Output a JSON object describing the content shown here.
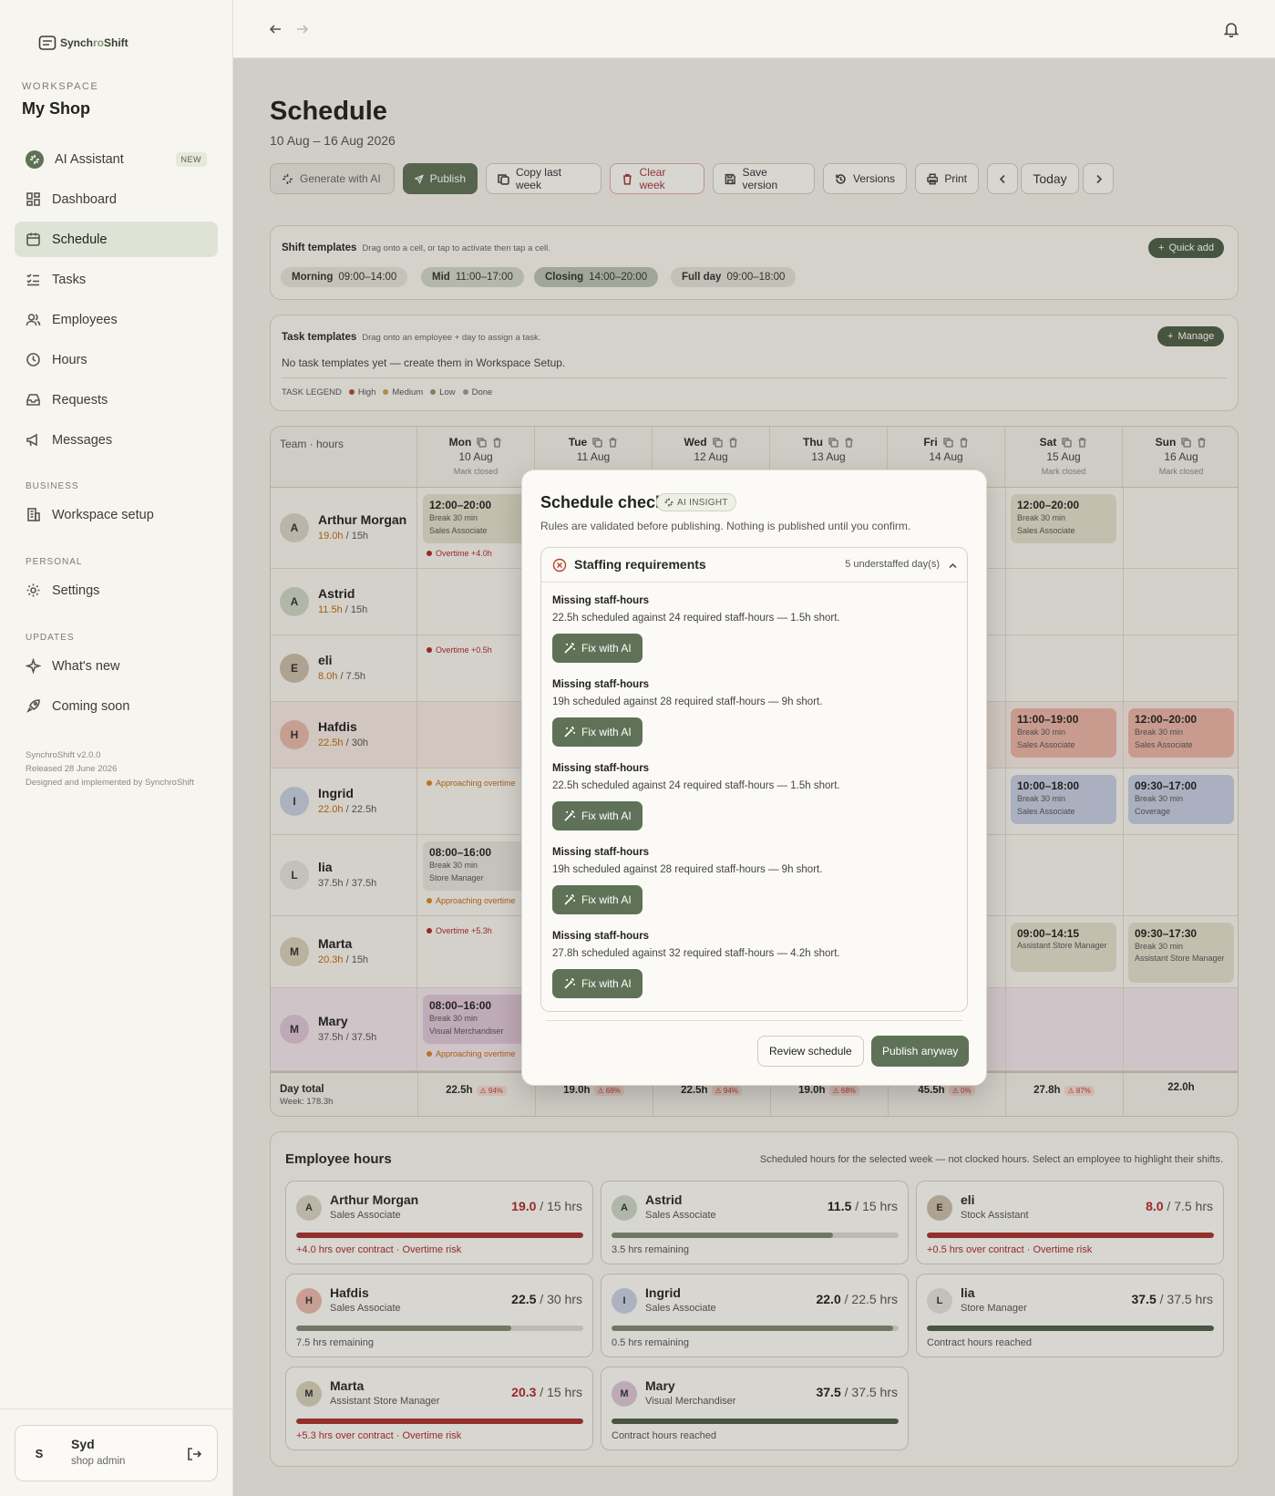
{
  "app": {
    "name_a": "Synch",
    "name_b": "ro",
    "name_c": "Shift"
  },
  "workspace": {
    "label": "WORKSPACE",
    "name": "My Shop"
  },
  "nav": {
    "ai": "AI Assistant",
    "new": "NEW",
    "dashboard": "Dashboard",
    "schedule": "Schedule",
    "tasks": "Tasks",
    "employees": "Employees",
    "hours": "Hours",
    "requests": "Requests",
    "messages": "Messages",
    "business_label": "BUSINESS",
    "workspace_setup": "Workspace setup",
    "personal_label": "PERSONAL",
    "settings": "Settings",
    "updates_label": "UPDATES",
    "whats_new": "What's new",
    "coming_soon": "Coming soon"
  },
  "version": {
    "line1": "SynchroShift v2.0.0",
    "line2": "Released 28 June 2026",
    "line3": "Designed and implemented by SynchroShift"
  },
  "user": {
    "initial": "S",
    "name": "Syd",
    "role": "shop admin"
  },
  "page": {
    "title": "Schedule",
    "range": "10 Aug – 16 Aug 2026"
  },
  "toolbar": {
    "generate": "Generate with AI",
    "publish": "Publish",
    "copy": "Copy last week",
    "clear": "Clear week",
    "save": "Save version",
    "versions": "Versions",
    "print": "Print",
    "today": "Today"
  },
  "shift_templates": {
    "title": "Shift templates",
    "hint": "Drag onto a cell, or tap to activate then tap a cell.",
    "quick_add": "Quick add",
    "chips": [
      {
        "name": "Morning",
        "time": "09:00–14:00"
      },
      {
        "name": "Mid",
        "time": "11:00–17:00"
      },
      {
        "name": "Closing",
        "time": "14:00–20:00"
      },
      {
        "name": "Full day",
        "time": "09:00–18:00"
      }
    ]
  },
  "task_templates": {
    "title": "Task templates",
    "hint": "Drag onto an employee + day to assign a task.",
    "manage": "Manage",
    "empty": "No task templates yet — create them in Workspace Setup.",
    "legend_label": "TASK LEGEND",
    "legend": [
      "High",
      "Medium",
      "Low",
      "Done"
    ],
    "legend_colors": [
      "#b24a3f",
      "#c9a44a",
      "#8a9a72",
      "#9a9a92"
    ]
  },
  "grid": {
    "corner": "Team · hours",
    "days": [
      {
        "day": "Mon",
        "date": "10 Aug",
        "note": "Mark closed"
      },
      {
        "day": "Tue",
        "date": "11 Aug",
        "note": ""
      },
      {
        "day": "Wed",
        "date": "12 Aug",
        "note": ""
      },
      {
        "day": "Thu",
        "date": "13 Aug",
        "note": ""
      },
      {
        "day": "Fri",
        "date": "14 Aug",
        "note": ""
      },
      {
        "day": "Sat",
        "date": "15 Aug",
        "note": "Mark closed"
      },
      {
        "day": "Sun",
        "date": "16 Aug",
        "note": "Mark closed"
      }
    ],
    "employees": [
      {
        "initial": "A",
        "name": "Arthur Morgan",
        "worked": "19.0h",
        "contract": " / 15h"
      },
      {
        "initial": "A",
        "name": "Astrid",
        "worked": "11.5h",
        "contract": " / 15h"
      },
      {
        "initial": "E",
        "name": "eli",
        "worked": "8.0h",
        "contract": " / 7.5h"
      },
      {
        "initial": "H",
        "name": "Hafdis",
        "worked": "22.5h",
        "contract": " / 30h"
      },
      {
        "initial": "I",
        "name": "Ingrid",
        "worked": "22.0h",
        "contract": " / 22.5h"
      },
      {
        "initial": "L",
        "name": "lia",
        "worked": "37.5h",
        "contract": " / 37.5h"
      },
      {
        "initial": "M",
        "name": "Marta",
        "worked": "20.3h",
        "contract": " / 15h"
      },
      {
        "initial": "M",
        "name": "Mary",
        "worked": "37.5h",
        "contract": " / 37.5h"
      }
    ],
    "shifts": {
      "arthur_mon": {
        "time": "12:00–20:00",
        "break": "Break 30 min",
        "role": "Sales Associate"
      },
      "arthur_sat": {
        "time": "12:00–20:00",
        "break": "Break 30 min",
        "role": "Sales Associate"
      },
      "hafdis_sat": {
        "time": "11:00–19:00",
        "break": "Break 30 min",
        "role": "Sales Associate"
      },
      "hafdis_sun": {
        "time": "12:00–20:00",
        "break": "Break 30 min",
        "role": "Sales Associate"
      },
      "ingrid_sat": {
        "time": "10:00–18:00",
        "break": "Break 30 min",
        "role": "Sales Associate"
      },
      "ingrid_sun": {
        "time": "09:30–17:00",
        "break": "Break 30 min",
        "role": "Coverage"
      },
      "lia_mon": {
        "time": "08:00–16:00",
        "break": "Break 30 min",
        "role": "Store Manager"
      },
      "marta_sat": {
        "time": "09:00–14:15",
        "role": "Assistant Store Manager"
      },
      "marta_sun": {
        "time": "09:30–17:30",
        "break": "Break 30 min",
        "role": "Assistant Store Manager"
      },
      "mary_mon": {
        "time": "08:00–16:00",
        "break": "Break 30 min",
        "role": "Visual Merchandiser"
      }
    },
    "flags": {
      "arthur": "Overtime +4.0h",
      "eli": "Overtime +0.5h",
      "ingrid": "Approaching overtime",
      "lia": "Approaching overtime",
      "marta": "Overtime +5.3h",
      "mary": "Approaching overtime"
    },
    "totals": {
      "label": "Day total",
      "week": "Week: 178.3h",
      "days": [
        {
          "hours": "22.5h",
          "pct": "94%"
        },
        {
          "hours": "19.0h",
          "pct": "68%"
        },
        {
          "hours": "22.5h",
          "pct": "94%"
        },
        {
          "hours": "19.0h",
          "pct": "68%"
        },
        {
          "hours": "45.5h",
          "pct": "0%"
        },
        {
          "hours": "27.8h",
          "pct": "87%"
        },
        {
          "hours": "22.0h",
          "pct": ""
        }
      ]
    }
  },
  "employee_hours": {
    "title": "Employee hours",
    "hint": "Scheduled hours for the selected week — not clocked hours. Select an employee to highlight their shifts.",
    "cards": [
      {
        "initial": "A",
        "name": "Arthur Morgan",
        "role": "Sales Associate",
        "hours": "19.0",
        "of": " / 15 hrs",
        "progress": 1.0,
        "note": "+4.0 hrs over contract · Overtime risk",
        "status": "over"
      },
      {
        "initial": "A",
        "name": "Astrid",
        "role": "Sales Associate",
        "hours": "11.5",
        "of": " / 15 hrs",
        "progress": 0.77,
        "note": "3.5 hrs remaining",
        "status": "under"
      },
      {
        "initial": "E",
        "name": "eli",
        "role": "Stock Assistant",
        "hours": "8.0",
        "of": " / 7.5 hrs",
        "progress": 1.0,
        "note": "+0.5 hrs over contract · Overtime risk",
        "status": "over"
      },
      {
        "initial": "H",
        "name": "Hafdis",
        "role": "Sales Associate",
        "hours": "22.5",
        "of": " / 30 hrs",
        "progress": 0.75,
        "note": "7.5 hrs remaining",
        "status": "under"
      },
      {
        "initial": "I",
        "name": "Ingrid",
        "role": "Sales Associate",
        "hours": "22.0",
        "of": " / 22.5 hrs",
        "progress": 0.98,
        "note": "0.5 hrs remaining",
        "status": "under"
      },
      {
        "initial": "L",
        "name": "lia",
        "role": "Store Manager",
        "hours": "37.5",
        "of": " / 37.5 hrs",
        "progress": 1.0,
        "note": "Contract hours reached",
        "status": "full"
      },
      {
        "initial": "M",
        "name": "Marta",
        "role": "Assistant Store Manager",
        "hours": "20.3",
        "of": " / 15 hrs",
        "progress": 1.0,
        "note": "+5.3 hrs over contract · Overtime risk",
        "status": "over"
      },
      {
        "initial": "M",
        "name": "Mary",
        "role": "Visual Merchandiser",
        "hours": "37.5",
        "of": " / 37.5 hrs",
        "progress": 1.0,
        "note": "Contract hours reached",
        "status": "full"
      }
    ]
  },
  "modal": {
    "title": "Schedule check",
    "badge": "AI INSIGHT",
    "subtitle": "Rules are validated before publishing. Nothing is published until you confirm.",
    "section": "Staffing requirements",
    "count": "5 understaffed day(s)",
    "issues": [
      {
        "title": "Missing staff-hours",
        "desc": "22.5h scheduled against 24 required staff-hours — 1.5h short.",
        "button": "Fix with AI"
      },
      {
        "title": "Missing staff-hours",
        "desc": "19h scheduled against 28 required staff-hours — 9h short.",
        "button": "Fix with AI"
      },
      {
        "title": "Missing staff-hours",
        "desc": "22.5h scheduled against 24 required staff-hours — 1.5h short.",
        "button": "Fix with AI"
      },
      {
        "title": "Missing staff-hours",
        "desc": "19h scheduled against 28 required staff-hours — 9h short.",
        "button": "Fix with AI"
      },
      {
        "title": "Missing staff-hours",
        "desc": "27.8h scheduled against 32 required staff-hours — 4.2h short.",
        "button": "Fix with AI"
      }
    ],
    "review": "Review schedule",
    "publish": "Publish anyway"
  },
  "colors": {
    "accent": "#5f7257",
    "danger": "#b02a2a",
    "warning": "#c06a10"
  }
}
